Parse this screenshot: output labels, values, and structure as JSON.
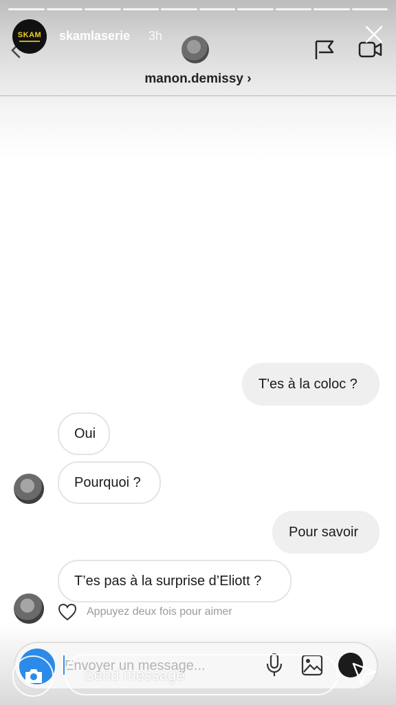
{
  "story": {
    "username": "skamlaserie",
    "time_ago": "3h",
    "logo_text": "SKAM",
    "segments": 10
  },
  "dm": {
    "username": "manon.demissy",
    "chevron": "›"
  },
  "messages": [
    {
      "id": "m1",
      "direction": "outgoing",
      "text": "T'es à la coloc ?"
    },
    {
      "id": "m2",
      "direction": "incoming",
      "text": "Oui"
    },
    {
      "id": "m3",
      "direction": "incoming",
      "text": "Pourquoi ?"
    },
    {
      "id": "m4",
      "direction": "outgoing",
      "text": "Pour savoir"
    },
    {
      "id": "m5",
      "direction": "incoming",
      "text": "T’es pas à la surprise d’Eliott ?"
    }
  ],
  "like_hint": "Appuyez deux fois pour aimer",
  "composer": {
    "placeholder": "Envoyer un message..."
  },
  "reply": {
    "placeholder": "Send message"
  },
  "icons": {
    "back": "back-arrow-icon",
    "close": "close-icon",
    "flag": "flag-icon",
    "video": "video-camera-icon",
    "heart": "heart-icon",
    "mic": "microphone-icon",
    "gallery": "gallery-icon",
    "plus": "plus-icon",
    "camera": "camera-icon",
    "send": "send-icon"
  },
  "colors": {
    "camera_blue": "#2c8ae8",
    "skam_yellow": "#f2d21a",
    "outgoing_bubble": "#efefef"
  }
}
